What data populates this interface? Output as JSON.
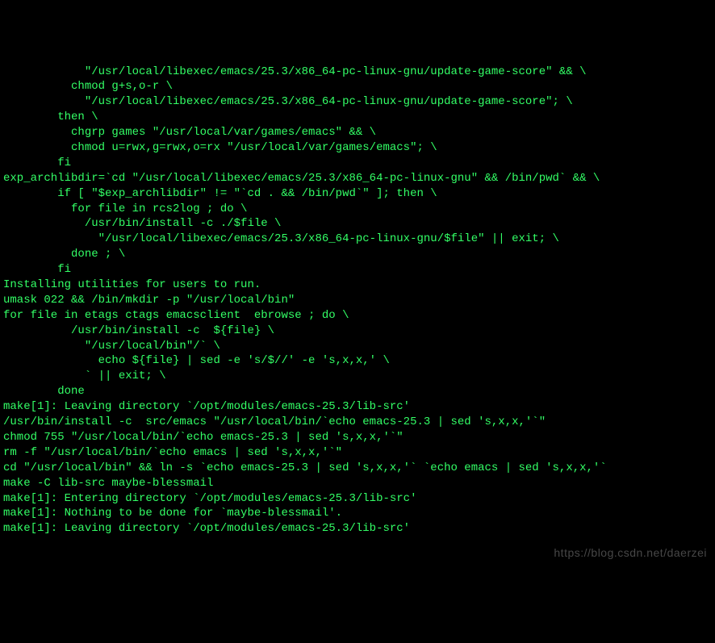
{
  "terminal": {
    "lines": [
      "            \"/usr/local/libexec/emacs/25.3/x86_64-pc-linux-gnu/update-game-score\" && \\",
      "          chmod g+s,o-r \\",
      "            \"/usr/local/libexec/emacs/25.3/x86_64-pc-linux-gnu/update-game-score\"; \\",
      "        then \\",
      "          chgrp games \"/usr/local/var/games/emacs\" && \\",
      "          chmod u=rwx,g=rwx,o=rx \"/usr/local/var/games/emacs\"; \\",
      "        fi",
      "exp_archlibdir=`cd \"/usr/local/libexec/emacs/25.3/x86_64-pc-linux-gnu\" && /bin/pwd` && \\",
      "        if [ \"$exp_archlibdir\" != \"`cd . && /bin/pwd`\" ]; then \\",
      "          for file in rcs2log ; do \\",
      "            /usr/bin/install -c ./$file \\",
      "              \"/usr/local/libexec/emacs/25.3/x86_64-pc-linux-gnu/$file\" || exit; \\",
      "          done ; \\",
      "        fi",
      "",
      "Installing utilities for users to run.",
      "umask 022 && /bin/mkdir -p \"/usr/local/bin\"",
      "for file in etags ctags emacsclient  ebrowse ; do \\",
      "          /usr/bin/install -c  ${file} \\",
      "            \"/usr/local/bin\"/` \\",
      "              echo ${file} | sed -e 's/$//' -e 's,x,x,' \\",
      "            ` || exit; \\",
      "        done",
      "make[1]: Leaving directory `/opt/modules/emacs-25.3/lib-src'",
      "/usr/bin/install -c  src/emacs \"/usr/local/bin/`echo emacs-25.3 | sed 's,x,x,'`\"",
      "chmod 755 \"/usr/local/bin/`echo emacs-25.3 | sed 's,x,x,'`\"",
      "rm -f \"/usr/local/bin/`echo emacs | sed 's,x,x,'`\"",
      "cd \"/usr/local/bin\" && ln -s `echo emacs-25.3 | sed 's,x,x,'` `echo emacs | sed 's,x,x,'`",
      "make -C lib-src maybe-blessmail",
      "make[1]: Entering directory `/opt/modules/emacs-25.3/lib-src'",
      "make[1]: Nothing to be done for `maybe-blessmail'.",
      "make[1]: Leaving directory `/opt/modules/emacs-25.3/lib-src'"
    ]
  },
  "watermark": {
    "text": "https://blog.csdn.net/daerzei"
  }
}
